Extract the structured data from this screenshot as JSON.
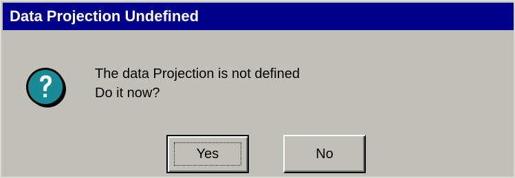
{
  "dialog": {
    "title": "Data Projection Undefined",
    "icon": "question-icon",
    "message_line1": "The data Projection is not defined",
    "message_line2": "Do it now?",
    "yes_label": "Yes",
    "no_label": "No"
  },
  "colors": {
    "titlebar": "#00008b",
    "title_text": "#ffffff",
    "dialog_bg": "#c0bfb8",
    "icon_fill": "#1a8a96"
  }
}
